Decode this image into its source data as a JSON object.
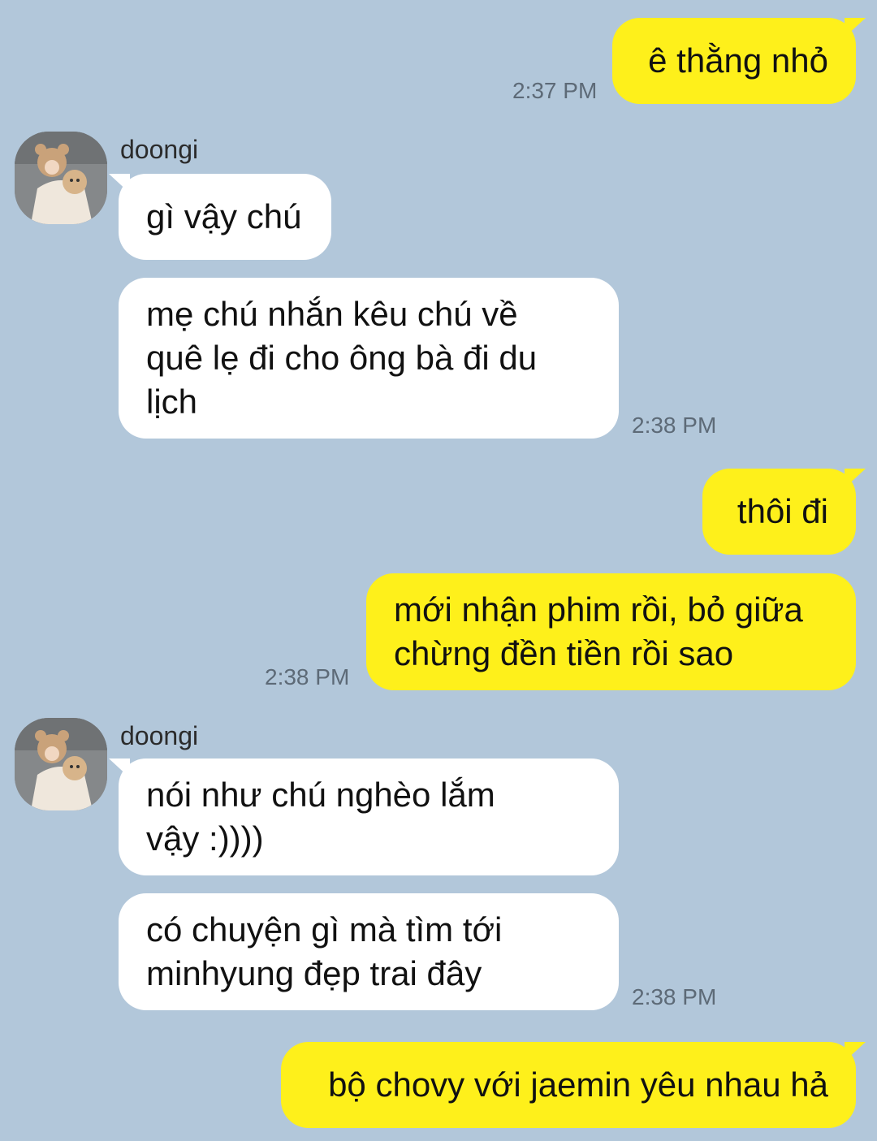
{
  "conversation": {
    "messages": [
      {
        "from": "me",
        "text": "ê thằng nhỏ",
        "time": "2:37 PM"
      },
      {
        "from": "doongi",
        "sender": "doongi",
        "text": "gì vậy chú"
      },
      {
        "from": "doongi",
        "text": "mẹ chú nhắn kêu chú về\nquê lẹ đi cho ông bà đi du\nlịch",
        "time": "2:38 PM"
      },
      {
        "from": "me",
        "text": "thôi đi"
      },
      {
        "from": "me",
        "text": "mới nhận phim rồi, bỏ giữa\nchừng đền tiền rồi sao",
        "time": "2:38 PM"
      },
      {
        "from": "doongi",
        "sender": "doongi",
        "text": "nói như chú nghèo lắm\nvậy :))))"
      },
      {
        "from": "doongi",
        "text": "có chuyện gì mà tìm tới\nminhyung đẹp trai đây",
        "time": "2:38 PM"
      },
      {
        "from": "me",
        "text": "bộ chovy với jaemin yêu nhau hả"
      }
    ]
  },
  "colors": {
    "background": "#b2c7da",
    "outgoing_bubble": "#fef01b",
    "incoming_bubble": "#ffffff",
    "timestamp": "#5d6a77"
  },
  "icons": {
    "avatar": "avatar-photo-bear-hat"
  }
}
